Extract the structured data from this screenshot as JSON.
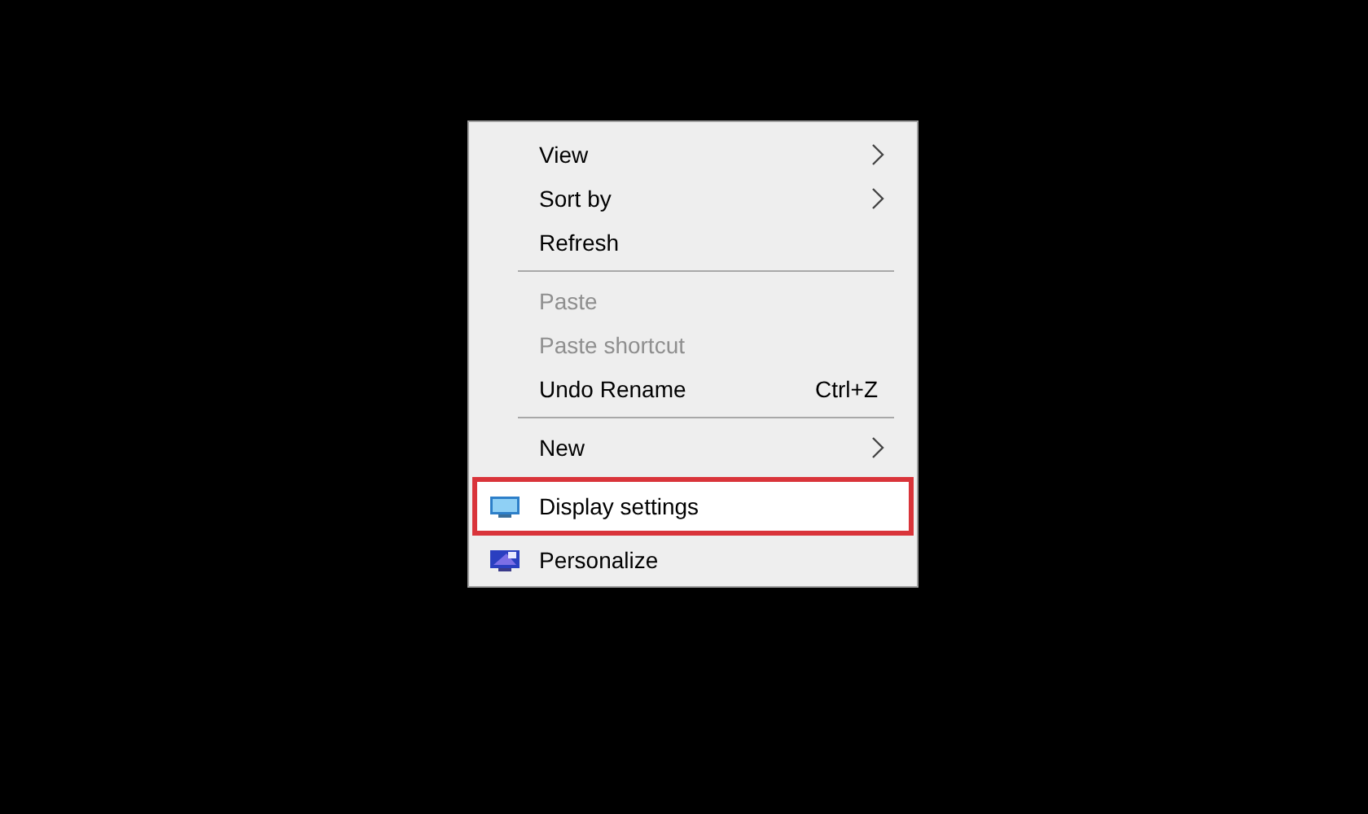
{
  "context_menu": {
    "items": [
      {
        "kind": "item",
        "label": "View",
        "submenu": true,
        "disabled": false,
        "highlighted": false
      },
      {
        "kind": "item",
        "label": "Sort by",
        "submenu": true,
        "disabled": false,
        "highlighted": false
      },
      {
        "kind": "item",
        "label": "Refresh",
        "submenu": false,
        "disabled": false,
        "highlighted": false
      },
      {
        "kind": "separator"
      },
      {
        "kind": "item",
        "label": "Paste",
        "submenu": false,
        "disabled": true,
        "highlighted": false
      },
      {
        "kind": "item",
        "label": "Paste shortcut",
        "submenu": false,
        "disabled": true,
        "highlighted": false
      },
      {
        "kind": "item",
        "label": "Undo Rename",
        "shortcut": "Ctrl+Z",
        "submenu": false,
        "disabled": false,
        "highlighted": false
      },
      {
        "kind": "separator"
      },
      {
        "kind": "item",
        "label": "New",
        "submenu": true,
        "disabled": false,
        "highlighted": false
      },
      {
        "kind": "monitor-item",
        "label": "Display settings",
        "submenu": false,
        "disabled": false,
        "highlighted": true
      },
      {
        "kind": "desktop-item",
        "label": "Personalize",
        "submenu": false,
        "disabled": false,
        "highlighted": false
      }
    ]
  }
}
